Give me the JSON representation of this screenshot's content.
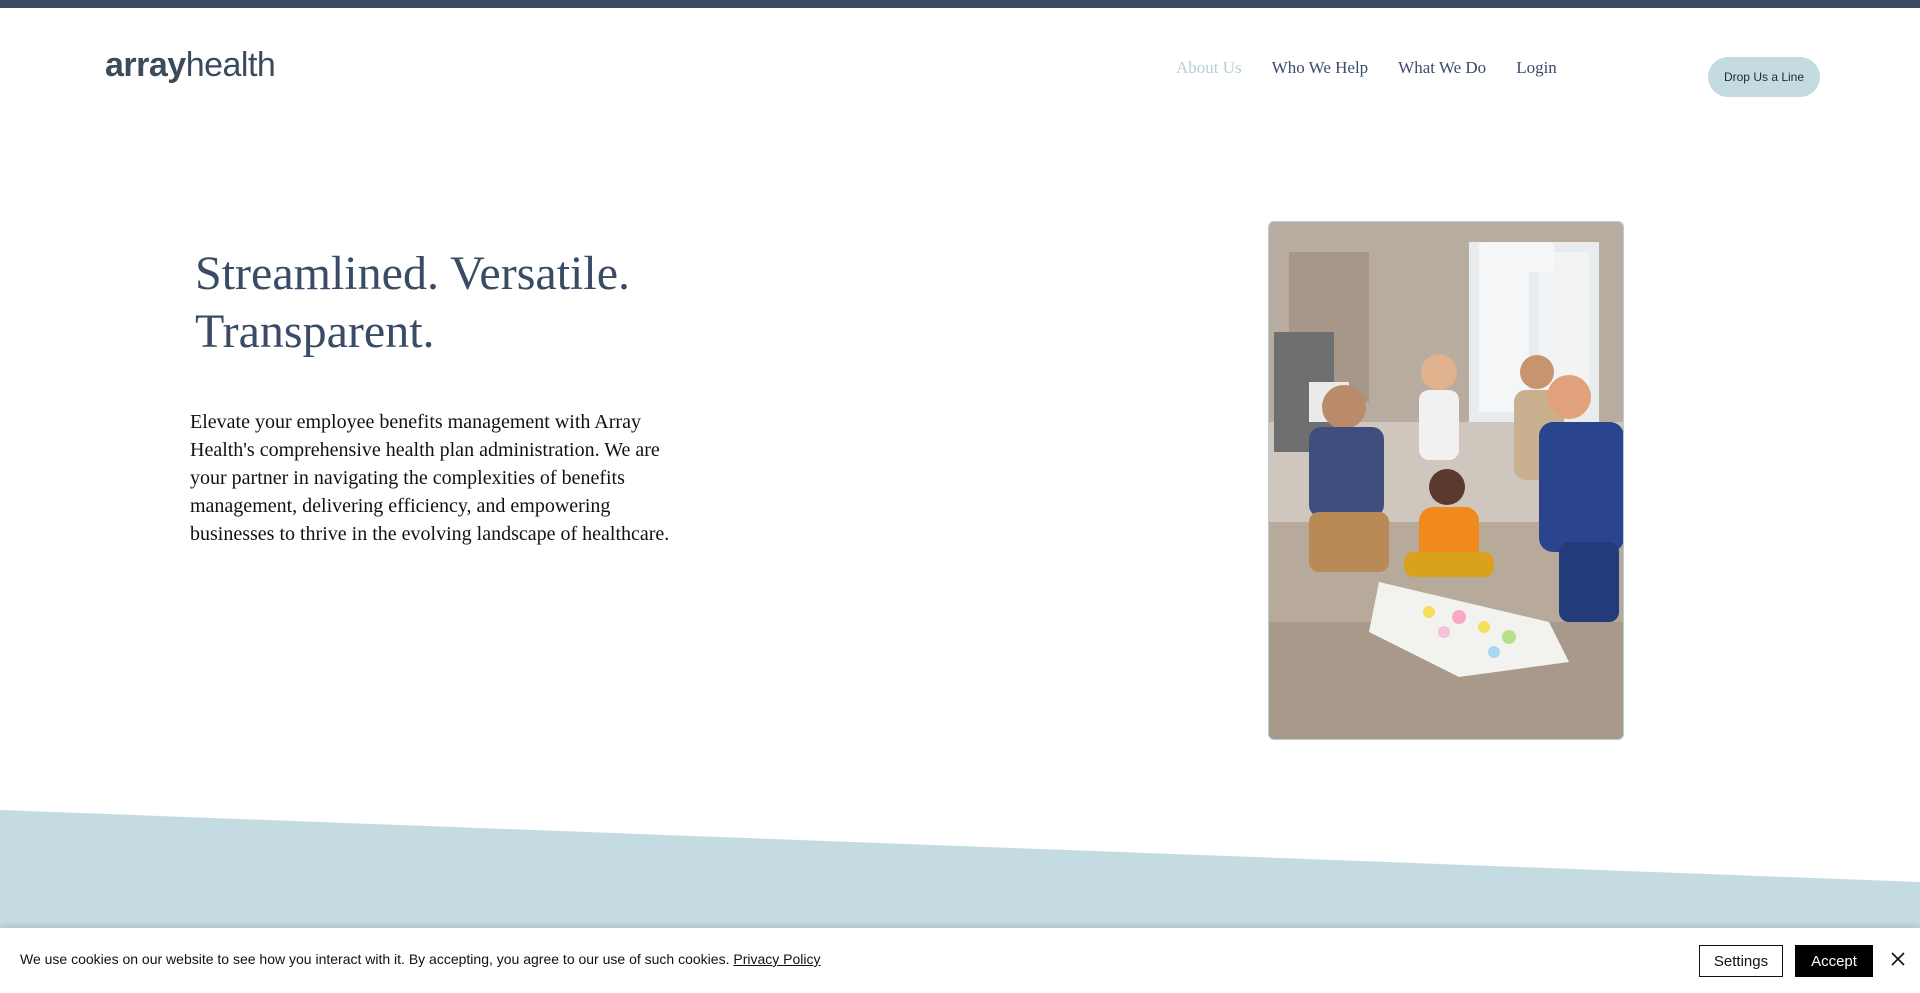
{
  "header": {
    "logo_bold": "array",
    "logo_light": "health",
    "nav": [
      {
        "label": "About Us",
        "active": true
      },
      {
        "label": "Who We Help",
        "active": false
      },
      {
        "label": "What We Do",
        "active": false
      },
      {
        "label": "Login",
        "active": false
      }
    ],
    "cta_label": "Drop Us a Line"
  },
  "hero": {
    "title_line1": "Streamlined. Versatile.",
    "title_line2": "Transparent.",
    "body": "Elevate your employee benefits management with Array Health's comprehensive health plan administration. We are your partner in navigating the complexities of benefits management, delivering efficiency, and empowering businesses to thrive in the evolving landscape of healthcare."
  },
  "cookie_banner": {
    "message": "We use cookies on our website to see how you interact with it. By accepting, you agree to our use of such cookies.",
    "privacy_link": "Privacy Policy",
    "settings_label": "Settings",
    "accept_label": "Accept",
    "close_icon": "close-icon"
  },
  "colors": {
    "top_bar": "#3b4b61",
    "brand_text": "#3a4b65",
    "nav_active": "#b9cfd7",
    "cta_bg": "#c4dbe1",
    "band": "#c4dbe1"
  }
}
